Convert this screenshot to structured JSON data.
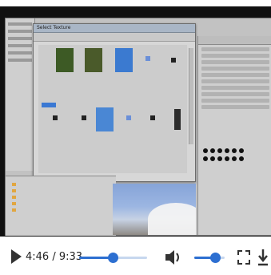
{
  "video": {
    "window_title": "Select Texture",
    "current_time": "4:46",
    "duration": "9:33",
    "progress": 0.5,
    "volume": 0.7
  },
  "colors": {
    "accent": "#2d6fd1",
    "track": "#c7d7ef"
  },
  "icons": {
    "play": "play-icon",
    "volume": "volume-icon",
    "fullscreen": "fullscreen-icon",
    "download": "download-icon"
  }
}
